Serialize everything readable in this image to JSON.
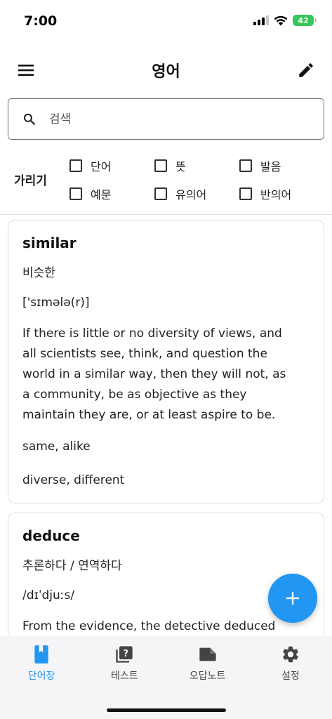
{
  "status": {
    "time": "7:00",
    "battery": "42"
  },
  "app_bar": {
    "title": "영어",
    "menu_icon": "menu-icon",
    "edit_icon": "pencil-icon"
  },
  "search": {
    "placeholder": "검색",
    "value": ""
  },
  "hide": {
    "label": "가리기",
    "options": [
      "단어",
      "뜻",
      "발음",
      "예문",
      "유의어",
      "반의어"
    ]
  },
  "cards": [
    {
      "word": "similar",
      "meaning": "비슷한",
      "pronunciation": "['sɪmələ(r)]",
      "example_lines": [
        "If there is little or no diversity of views, and",
        "all scientists see, think, and question the",
        "world in a similar way, then they will not, as",
        "a community, be as objective as they",
        "maintain they are, or at least aspire to be."
      ],
      "synonyms": "same, alike",
      "antonyms": "diverse, different"
    },
    {
      "word": "deduce",
      "meaning": "추론하다 / 연역하다",
      "pronunciation": "/dɪˈdjuːs/",
      "example_lines": [
        "From the evidence, the detective deduced"
      ]
    }
  ],
  "bottom_nav": [
    {
      "label": "단어장",
      "icon": "book-icon",
      "active": true
    },
    {
      "label": "테스트",
      "icon": "quiz-icon",
      "active": false
    },
    {
      "label": "오답노트",
      "icon": "folder-icon",
      "active": false
    },
    {
      "label": "설정",
      "icon": "gear-icon",
      "active": false
    }
  ],
  "colors": {
    "accent": "#2196f3",
    "battery": "#34c759"
  }
}
